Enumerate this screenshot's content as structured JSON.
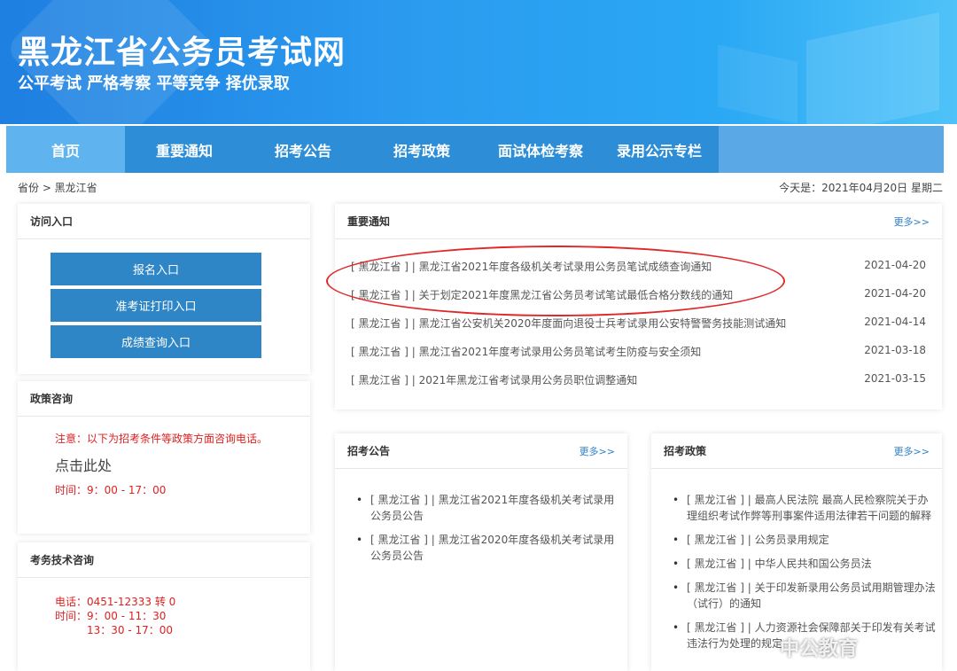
{
  "header": {
    "site_title": "黑龙江省公务员考试网",
    "slogan": "公平考试 严格考察 平等竞争 择优录取"
  },
  "nav": {
    "items": [
      {
        "label": "首页",
        "active": true
      },
      {
        "label": "重要通知"
      },
      {
        "label": "招考公告"
      },
      {
        "label": "招考政策"
      },
      {
        "label": "面试体检考察"
      },
      {
        "label": "录用公示专栏"
      }
    ]
  },
  "breadcrumb": "省份 > 黑龙江省",
  "today": "今天是：2021年04月20日 星期二",
  "access": {
    "title": "访问入口",
    "buttons": [
      "报名入口",
      "准考证打印入口",
      "成绩查询入口"
    ]
  },
  "policy_consult": {
    "title": "政策咨询",
    "notice": "注意：以下为招考条件等政策方面咨询电话。",
    "click_here": "点击此处",
    "hours": "时间：9：00 - 17：00"
  },
  "tech_consult": {
    "title": "考务技术咨询",
    "phone": "电话：0451-12333 转 0",
    "hours1": "时间：9：00 - 11：30",
    "hours2": "13：30 - 17：00"
  },
  "important": {
    "title": "重要通知",
    "more": "更多>>",
    "items": [
      {
        "title": "[ 黑龙江省 ] | 黑龙江省2021年度各级机关考试录用公务员笔试成绩查询通知",
        "date": "2021-04-20"
      },
      {
        "title": "[ 黑龙江省 ] | 关于划定2021年度黑龙江省公务员考试笔试最低合格分数线的通知",
        "date": "2021-04-20"
      },
      {
        "title": "[ 黑龙江省 ] | 黑龙江省公安机关2020年度面向退役士兵考试录用公安特警警务技能测试通知",
        "date": "2021-04-14"
      },
      {
        "title": "[ 黑龙江省 ] | 黑龙江省2021年度考试录用公务员笔试考生防疫与安全须知",
        "date": "2021-03-18"
      },
      {
        "title": "[ 黑龙江省 ] | 2021年黑龙江省考试录用公务员职位调整通知",
        "date": "2021-03-15"
      }
    ]
  },
  "recruit": {
    "title": "招考公告",
    "more": "更多>>",
    "items": [
      "[ 黑龙江省 ] | 黑龙江省2021年度各级机关考试录用公务员公告",
      "[ 黑龙江省 ] | 黑龙江省2020年度各级机关考试录用公务员公告"
    ]
  },
  "policy": {
    "title": "招考政策",
    "more": "更多>>",
    "items": [
      "[ 黑龙江省 ] | 最高人民法院 最高人民检察院关于办理组织考试作弊等刑事案件适用法律若干问题的解释",
      "[ 黑龙江省 ] | 公务员录用规定",
      "[ 黑龙江省 ] | 中华人民共和国公务员法",
      "[ 黑龙江省 ] | 关于印发新录用公务员试用期管理办法（试行）的通知",
      "[ 黑龙江省 ] | 人力资源社会保障部关于印发有关考试违法行为处理的规定"
    ]
  },
  "watermark": "中公教育"
}
